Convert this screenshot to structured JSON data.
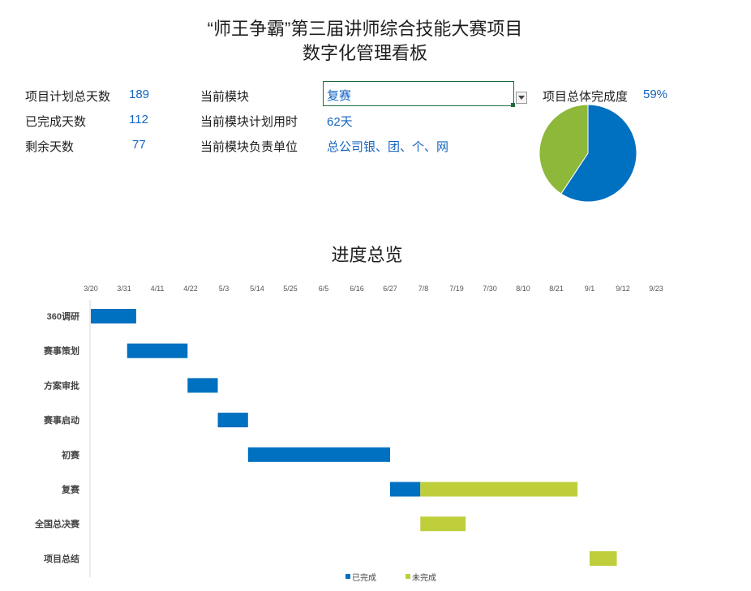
{
  "header": {
    "title_line1": "“师王争霸”第三届讲师综合技能大赛项目",
    "title_line2": "数字化管理看板"
  },
  "stats": {
    "total_days_label": "项目计划总天数",
    "total_days_value": "189",
    "done_days_label": "已完成天数",
    "done_days_value": "112",
    "remaining_days_label": "剩余天数",
    "remaining_days_value": "77"
  },
  "module": {
    "current_label": "当前模块",
    "current_value": "复赛",
    "plan_days_label": "当前模块计划用时",
    "plan_days_value": "62天",
    "owner_label": "当前模块负责单位",
    "owner_value": "总公司银、团、个、网",
    "dropdown_icon": "chevron-down-icon"
  },
  "completion": {
    "label": "项目总体完成度",
    "value_text": "59%",
    "fraction": 0.593,
    "colors": {
      "done": "#0070c0",
      "remaining": "#8db83a"
    }
  },
  "chart_data": {
    "type": "bar",
    "subtype": "gantt",
    "title": "进度总览",
    "x_ticks": [
      "3/20",
      "3/31",
      "4/11",
      "4/22",
      "5/3",
      "5/14",
      "5/25",
      "6/5",
      "6/16",
      "6/27",
      "7/8",
      "7/19",
      "7/30",
      "8/10",
      "8/21",
      "9/1",
      "9/12",
      "9/23"
    ],
    "xlim": [
      "3/20",
      "9/26"
    ],
    "categories": [
      "360调研",
      "赛事策划",
      "方案审批",
      "赛事启动",
      "初赛",
      "复赛",
      "全国总决赛",
      "项目总结"
    ],
    "series": [
      {
        "name": "已完成",
        "color": "#0070c0",
        "start": [
          "3/20",
          "4/1",
          "4/21",
          "5/1",
          "5/11",
          "6/27",
          "7/7",
          "9/1"
        ],
        "days": [
          15,
          20,
          10,
          10,
          47,
          10,
          0,
          0
        ]
      },
      {
        "name": "未完成",
        "color": "#bfcf3c",
        "start": [
          "3/20",
          "4/1",
          "4/21",
          "5/1",
          "5/11",
          "6/27",
          "7/7",
          "9/1"
        ],
        "offset_days": [
          0,
          0,
          0,
          0,
          0,
          10,
          0,
          0
        ],
        "days": [
          0,
          0,
          0,
          0,
          0,
          52,
          15,
          9
        ]
      }
    ],
    "legend_position": "bottom"
  }
}
